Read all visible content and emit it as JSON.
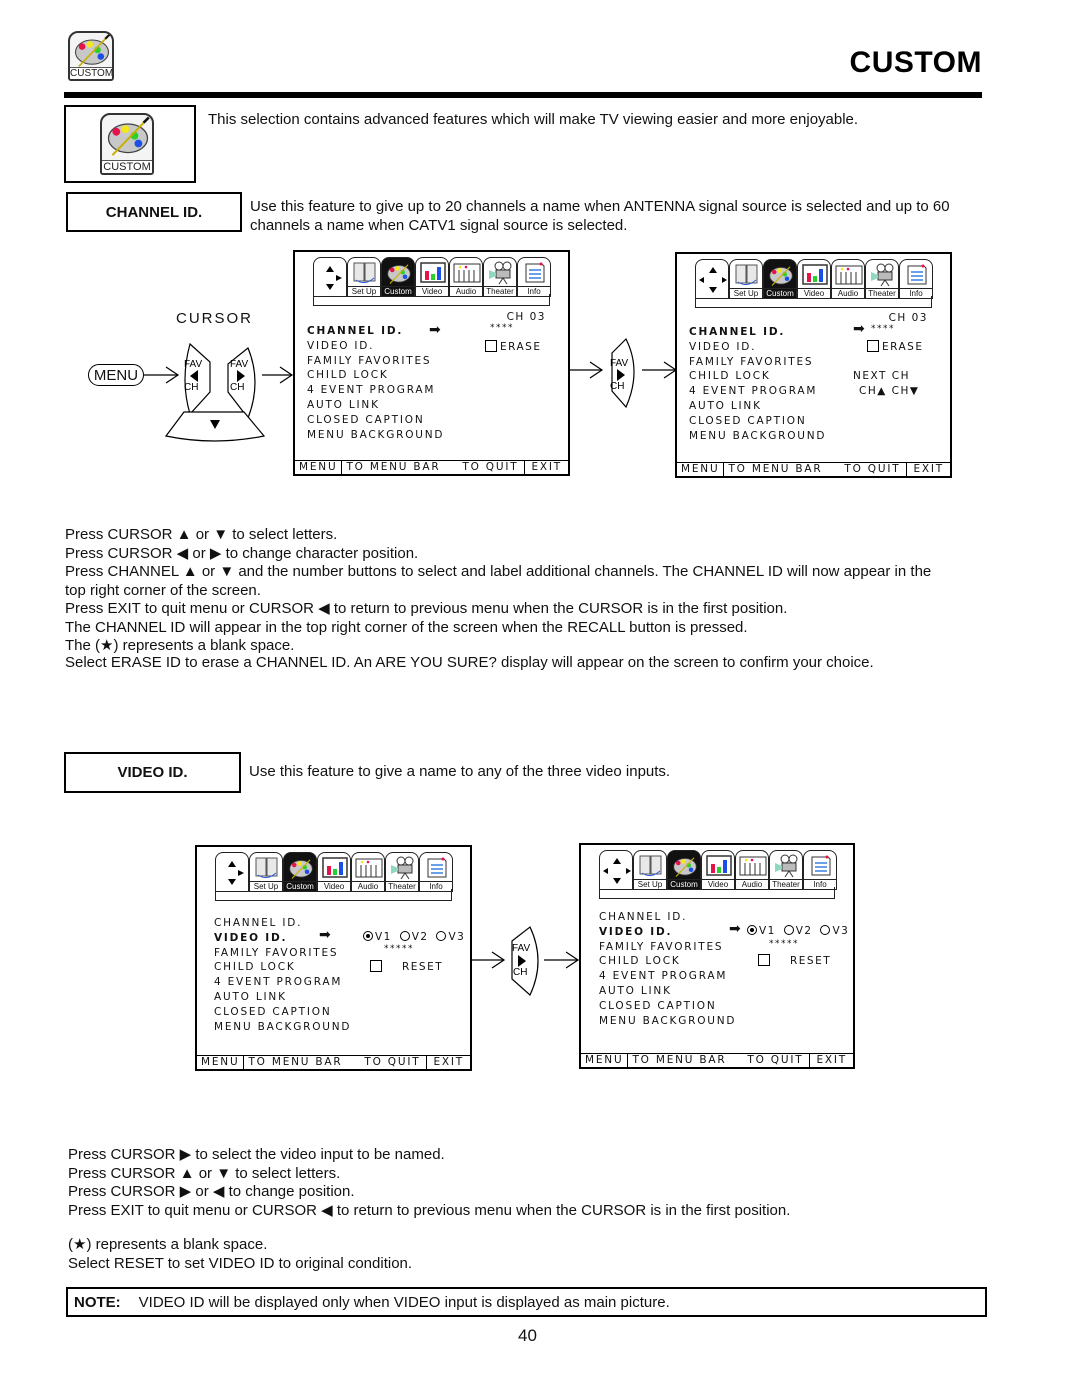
{
  "header": {
    "title": "CUSTOM",
    "icon_label": "CUSTOM"
  },
  "intro": {
    "icon_label": "CUSTOM",
    "text": "This selection contains advanced features which will make TV viewing easier and more enjoyable."
  },
  "channel_id": {
    "heading": "CHANNEL ID.",
    "description": "Use this feature to give up to 20 channels a name when ANTENNA signal source is selected and up to 60 channels a name when CATV1 signal source is selected.",
    "remote": {
      "cursor_label": "CURSOR",
      "menu_label": "MENU",
      "fav_label": "FAV",
      "ch_label": "CH"
    },
    "screen1": {
      "channel": "CH 03",
      "value": "****",
      "erase": "ERASE"
    },
    "screen2": {
      "channel": "CH 03",
      "value": "****",
      "erase": "ERASE",
      "next_ch": "NEXT CH",
      "ch_up": "CH▲",
      "ch_down": "CH▼"
    },
    "instructions": [
      "Press CURSOR ▲ or ▼ to select letters.",
      "Press CURSOR ◀ or ▶ to change character position.",
      "Press CHANNEL ▲ or ▼ and the number buttons to select and label additional channels.  The CHANNEL ID will now appear in the",
      "top right corner of the screen.",
      "Press EXIT to quit menu or CURSOR ◀ to return to previous menu when the CURSOR is in the first position.",
      "The CHANNEL ID will appear in the top right corner of the screen when the RECALL button is pressed.",
      "The (★) represents a blank space.",
      "Select ERASE ID to erase a CHANNEL ID.  An  ARE YOU SURE?  display will appear on the screen to confirm your choice."
    ]
  },
  "menu": {
    "tabs": [
      "Set Up",
      "Custom",
      "Video",
      "Audio",
      "Theater",
      "Info"
    ],
    "items": [
      "CHANNEL ID.",
      "VIDEO ID.",
      "FAMILY FAVORITES",
      "CHILD LOCK",
      "4 EVENT PROGRAM",
      "AUTO LINK",
      "CLOSED CAPTION",
      "MENU BACKGROUND"
    ],
    "footer": {
      "menu": "MENU",
      "to_menu_bar": "TO MENU BAR",
      "to_quit": "TO QUIT",
      "exit": "EXIT"
    }
  },
  "video_id": {
    "heading": "VIDEO ID.",
    "description": "Use this feature to give a name to any of the three video inputs.",
    "inputs": [
      "V1",
      "V2",
      "V3"
    ],
    "selected_input": "V1",
    "value": "*****",
    "reset": "RESET",
    "instructions": [
      "Press CURSOR ▶ to select the video input to be named.",
      "Press CURSOR ▲ or ▼ to select letters.",
      "Press CURSOR ▶ or ◀ to change position.",
      "Press EXIT to quit menu or CURSOR ◀ to return to previous menu when the CURSOR is in the first position.",
      "",
      "(★) represents a blank space.",
      "Select RESET to set VIDEO ID to original condition."
    ]
  },
  "note": {
    "label": "NOTE:",
    "text": "VIDEO ID will be displayed only when VIDEO input is displayed as main picture."
  },
  "page_number": "40"
}
